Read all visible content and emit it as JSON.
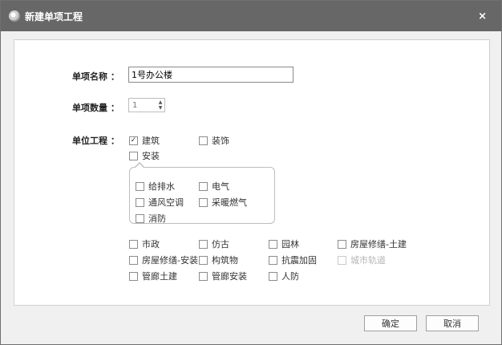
{
  "dialog": {
    "title": "新建单项工程",
    "close_label": "×"
  },
  "form": {
    "name_label": "单项名称 ：",
    "name_value": "1号办公楼",
    "count_label": "单项数量 ：",
    "count_value": "1",
    "unit_label": "单位工程 ："
  },
  "units": {
    "building": {
      "label": "建筑",
      "checked": true
    },
    "decoration": {
      "label": "装饰",
      "checked": false
    },
    "install": {
      "label": "安装",
      "checked": false
    }
  },
  "install_options": [
    {
      "label": "给排水",
      "checked": false
    },
    {
      "label": "电气",
      "checked": false
    },
    {
      "label": "通风空调",
      "checked": false
    },
    {
      "label": "采暖燃气",
      "checked": false
    },
    {
      "label": "消防",
      "checked": false
    }
  ],
  "other_units": [
    {
      "label": "市政",
      "enabled": true
    },
    {
      "label": "仿古",
      "enabled": true
    },
    {
      "label": "园林",
      "enabled": true
    },
    {
      "label": "房屋修缮-土建",
      "enabled": true
    },
    {
      "label": "房屋修缮-安装",
      "enabled": true
    },
    {
      "label": "构筑物",
      "enabled": true
    },
    {
      "label": "抗震加固",
      "enabled": true
    },
    {
      "label": "城市轨道",
      "enabled": false
    },
    {
      "label": "管廊土建",
      "enabled": true
    },
    {
      "label": "管廊安装",
      "enabled": true
    },
    {
      "label": "人防",
      "enabled": true
    }
  ],
  "buttons": {
    "ok": "确定",
    "cancel": "取消"
  },
  "colors": {
    "titlebar": "#676767",
    "disabled_text": "#b5b5b5"
  }
}
